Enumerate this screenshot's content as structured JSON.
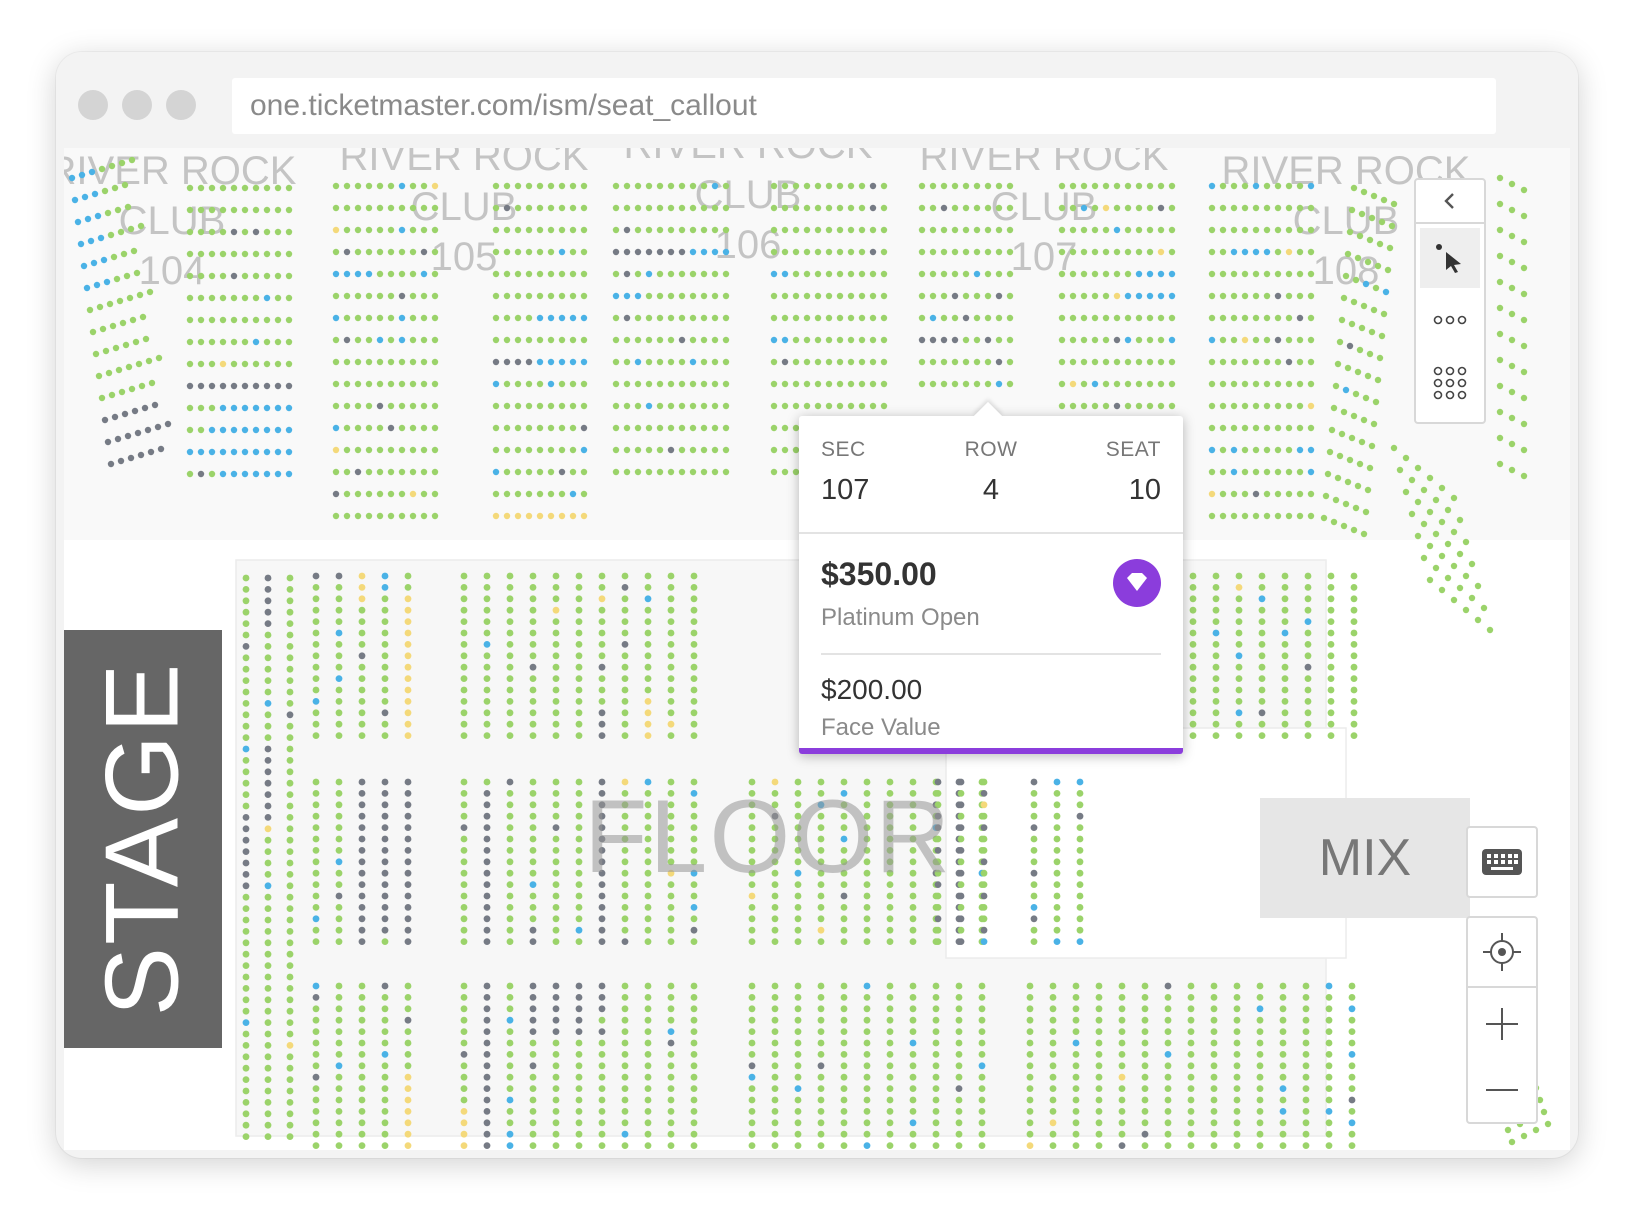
{
  "browser": {
    "url": "one.ticketmaster.com/ism/seat_callout"
  },
  "map": {
    "club_sections": [
      {
        "line1": "RIVER ROCK",
        "line2": "CLUB",
        "number": "104"
      },
      {
        "line1": "RIVER ROCK",
        "line2": "CLUB",
        "number": "105"
      },
      {
        "line1": "RIVER ROCK",
        "line2": "CLUB",
        "number": "106"
      },
      {
        "line1": "RIVER ROCK",
        "line2": "CLUB",
        "number": "107"
      },
      {
        "line1": "RIVER ROCK",
        "line2": "CLUB",
        "number": "108"
      }
    ],
    "stage_label": "STAGE",
    "floor_label": "FLOOR",
    "mix_label": "MIX",
    "seat_colors": {
      "available": "#9bd36a",
      "sold": "#767b85",
      "resale": "#4ab2e6",
      "special": "#f4d97a"
    }
  },
  "seat_popup": {
    "sec_label": "SEC",
    "sec_value": "107",
    "row_label": "ROW",
    "row_value": "4",
    "seat_label": "SEAT",
    "seat_value": "10",
    "price": "$350.00",
    "price_type": "Platinum Open",
    "face_value_price": "$200.00",
    "face_value_label": "Face Value",
    "accent_color": "#8b3ddc",
    "badge_icon": "diamond-icon"
  },
  "controls": {
    "top_panel": [
      "collapse-chevron-icon",
      "pointer-select-icon",
      "row-select-icon",
      "section-select-icon"
    ],
    "keyboard_icon": "keyboard-icon",
    "zoom_panel": [
      "locate-icon",
      "zoom-in-icon",
      "zoom-out-icon"
    ]
  }
}
